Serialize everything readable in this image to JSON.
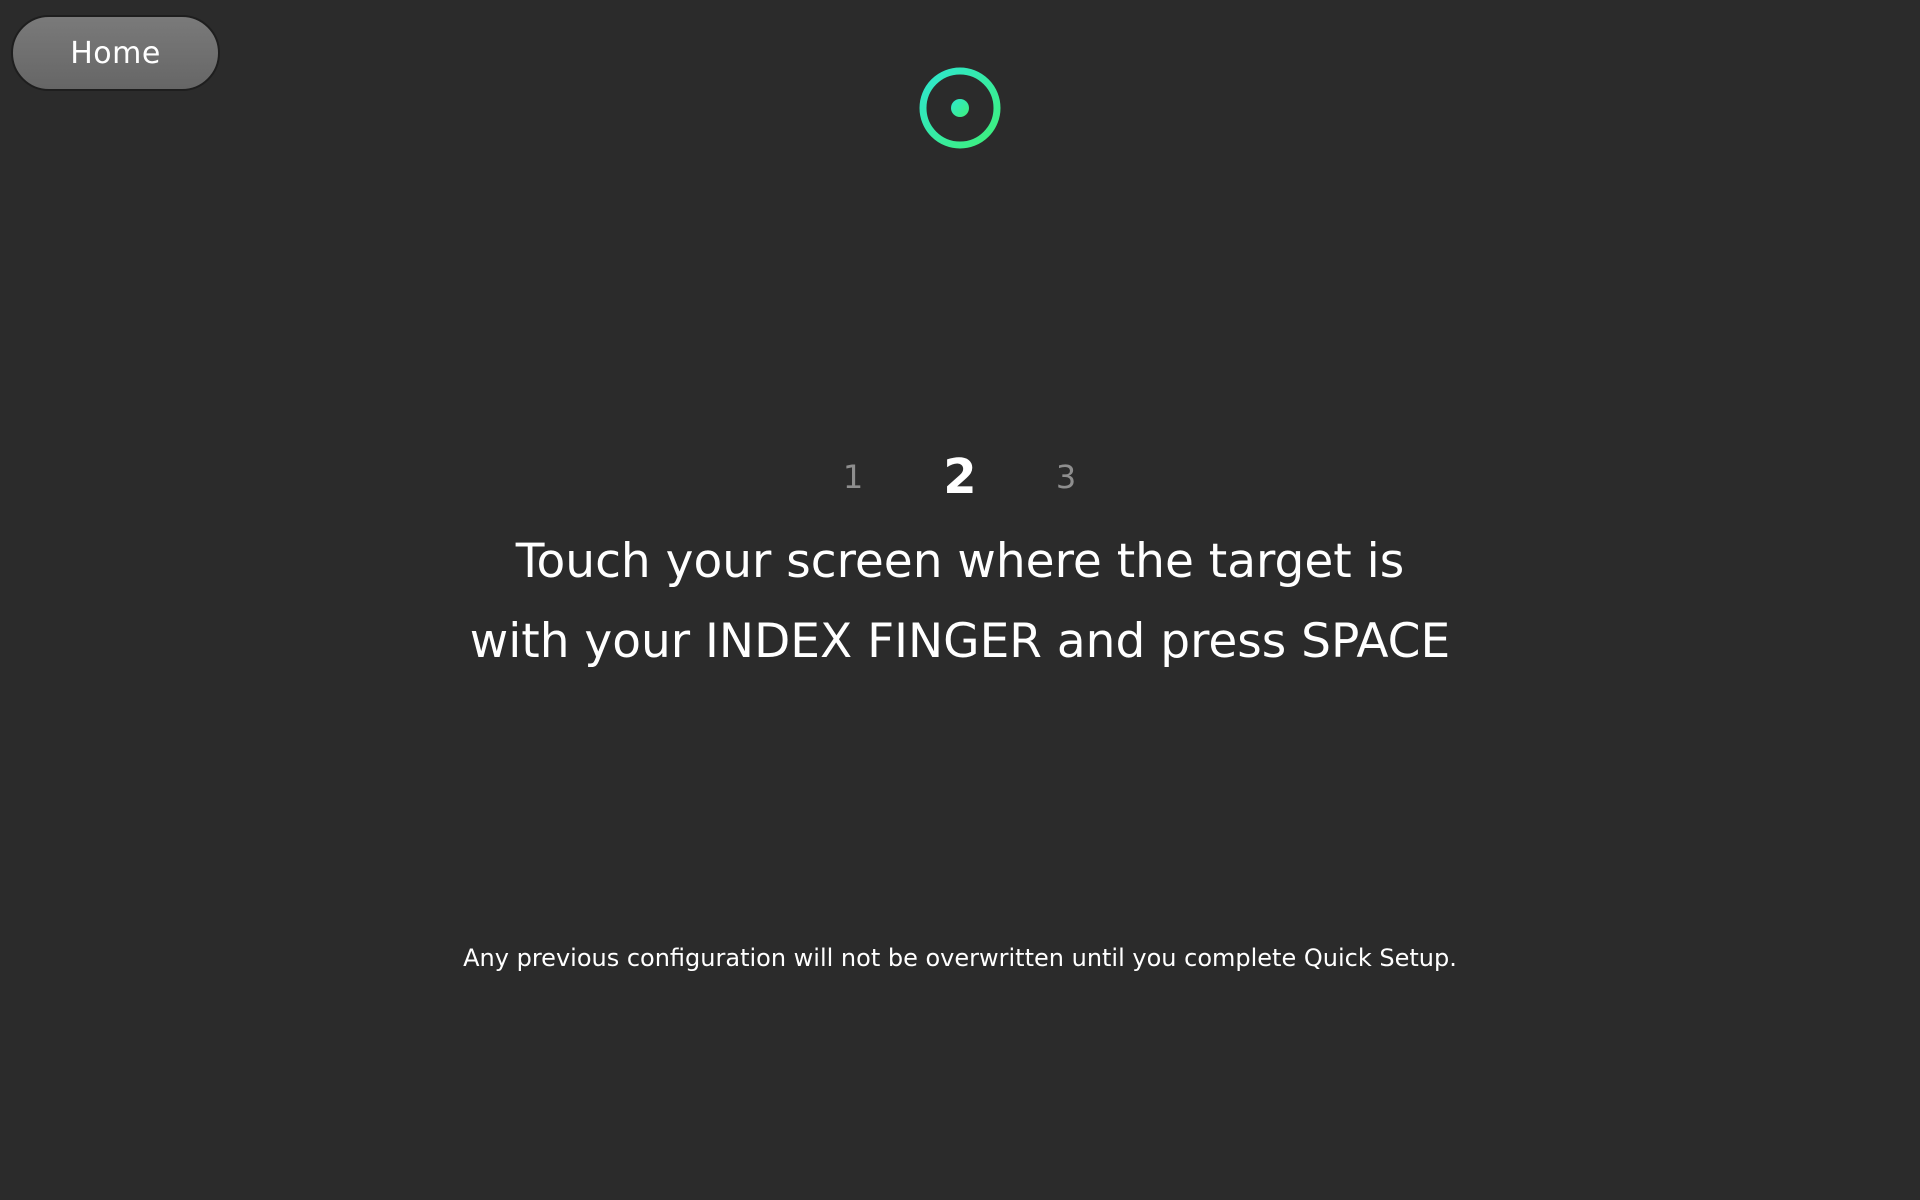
{
  "header": {
    "home_label": "Home",
    "target_icon": "crosshair-target-icon"
  },
  "colors": {
    "background": "#2b2b2b",
    "target_gradient_start": "#2ee6d0",
    "target_gradient_end": "#3ef07a",
    "step_inactive": "#8e8e8e",
    "step_active": "#ffffff"
  },
  "steps": {
    "items": [
      "1",
      "2",
      "3"
    ],
    "active_index": 1
  },
  "instructions": {
    "line1": "Touch your screen where the target is",
    "line2": "with your INDEX FINGER and press SPACE"
  },
  "footnote": "Any previous configuration will not be overwritten until you complete Quick Setup."
}
